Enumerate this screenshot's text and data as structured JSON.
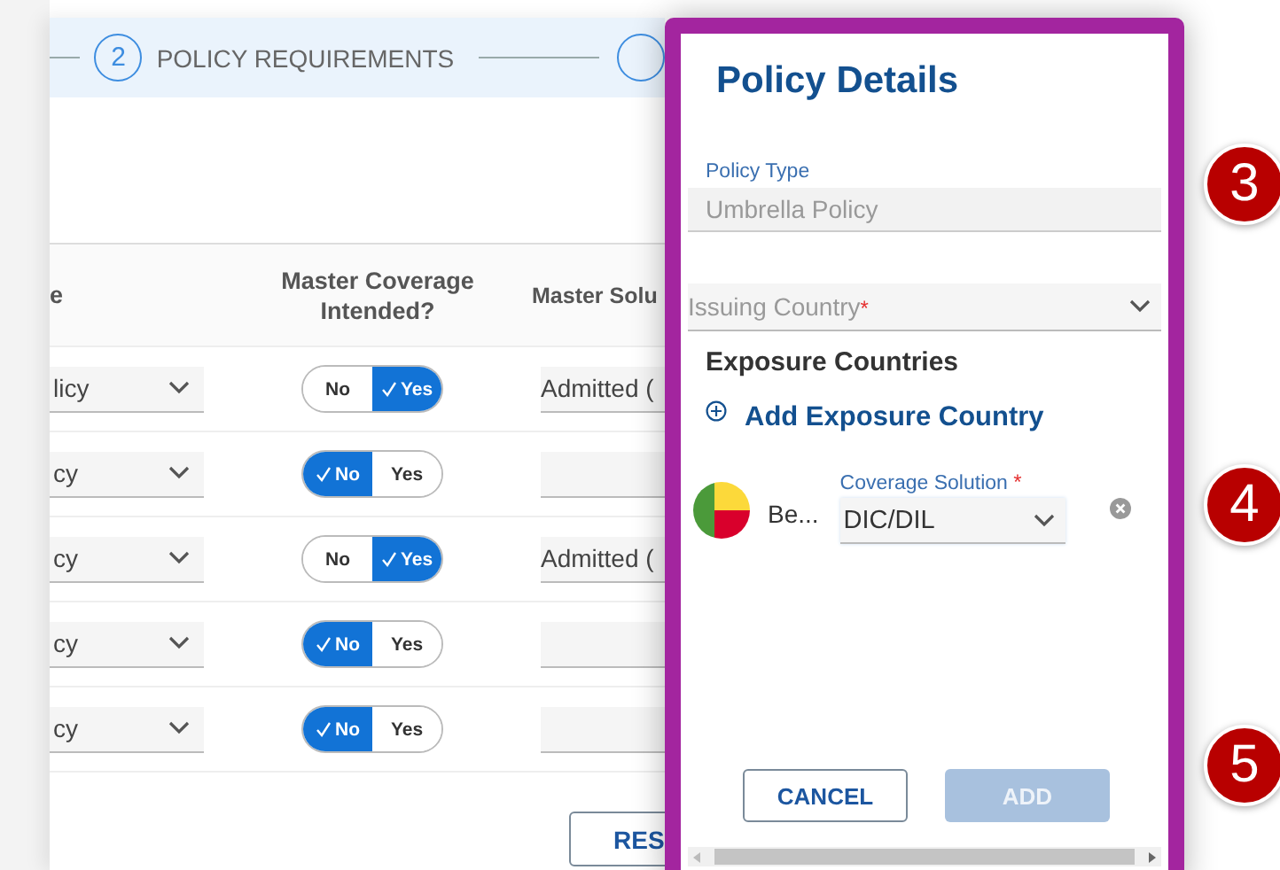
{
  "stepper": {
    "number": "2",
    "label": "POLICY REQUIREMENTS"
  },
  "table": {
    "columns": [
      "e",
      "Master Coverage Intended?",
      "Master Solu"
    ],
    "rows": [
      {
        "policy_type": "licy",
        "master_coverage": [
          {
            "label": "No",
            "selected": false
          },
          {
            "label": "Yes",
            "selected": true
          }
        ],
        "master_solution": "Admitted ("
      },
      {
        "policy_type": "cy",
        "master_coverage": [
          {
            "label": "No",
            "selected": true
          },
          {
            "label": "Yes",
            "selected": false
          }
        ]
      },
      {
        "policy_type": "cy",
        "master_coverage": [
          {
            "label": "No",
            "selected": false
          },
          {
            "label": "Yes",
            "selected": true
          }
        ],
        "master_solution": "Admitted ("
      },
      {
        "policy_type": "cy",
        "master_coverage": [
          {
            "label": "No",
            "selected": true
          },
          {
            "label": "Yes",
            "selected": false
          }
        ]
      },
      {
        "policy_type": "cy",
        "master_coverage": [
          {
            "label": "No",
            "selected": true
          },
          {
            "label": "Yes",
            "selected": false
          }
        ]
      }
    ]
  },
  "reset_button": "RES",
  "modal": {
    "title": "Policy Details",
    "policy_type": {
      "label": "Policy Type",
      "value": "Umbrella Policy",
      "disabled": true
    },
    "issuing_country": {
      "placeholder": "Issuing Country",
      "required_mark": "*"
    },
    "exposure_heading": "Exposure Countries",
    "add_link": "Add Exposure Country",
    "countries": [
      {
        "name": "Be...",
        "coverage_label": "Coverage Solution",
        "required_mark": "*",
        "coverage_value": "DIC/DIL"
      }
    ],
    "buttons": [
      {
        "label": "CANCEL",
        "kind": "outline",
        "disabled": false
      },
      {
        "label": "ADD",
        "kind": "primary",
        "disabled": true
      }
    ]
  },
  "badges": [
    "3",
    "4",
    "5"
  ]
}
